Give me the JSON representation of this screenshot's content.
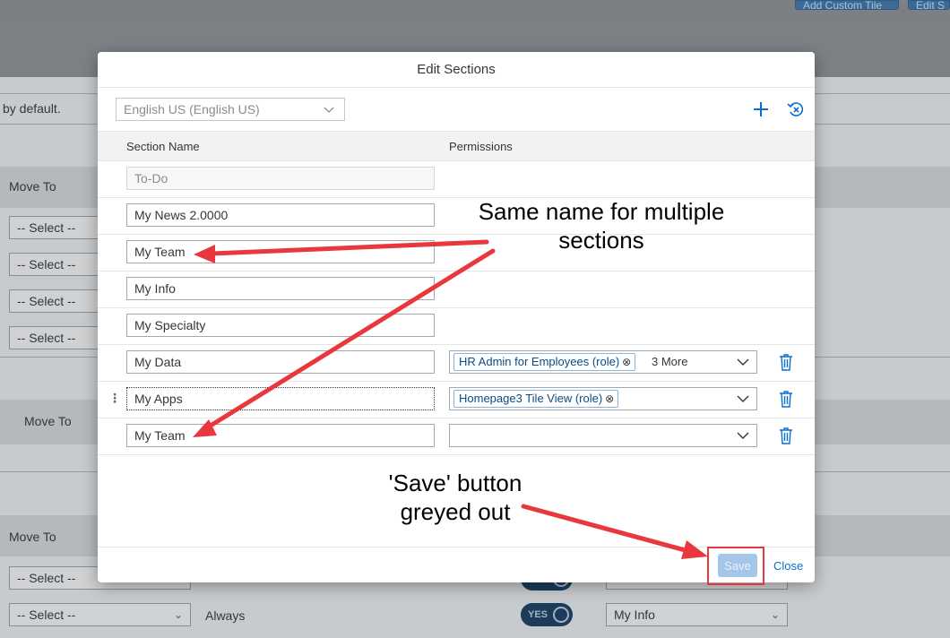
{
  "background": {
    "top_buttons": [
      "Add Custom Tile",
      "Edit S"
    ],
    "default_text": "by default.",
    "move_to": [
      "Move To",
      "Move To",
      "Move To"
    ],
    "select_placeholder": "-- Select --",
    "always_label": "Always",
    "toggle_label": "YES",
    "bottom_select_value": "My Info"
  },
  "dialog": {
    "title": "Edit Sections",
    "language": "English US (English US)",
    "columns": {
      "section_name": "Section Name",
      "permissions": "Permissions"
    },
    "rows": [
      {
        "name": "To-Do"
      },
      {
        "name": "My News 2.0000"
      },
      {
        "name": "My Team"
      },
      {
        "name": "My Info"
      },
      {
        "name": "My Specialty"
      },
      {
        "name": "My Data",
        "token": "HR Admin for Employees (role)",
        "more": "3 More"
      },
      {
        "name": "My Apps",
        "token": "Homepage3 Tile View (role)"
      },
      {
        "name": "My Team"
      }
    ],
    "save_label": "Save",
    "close_label": "Close"
  },
  "annotations": {
    "same_name_line1": "Same name for multiple",
    "same_name_line2": "sections",
    "save_line1": "'Save' button",
    "save_line2": "greyed out"
  },
  "colors": {
    "accent": "#0a6ed1",
    "annotation": "#e8383d",
    "save_disabled": "#a4c6e8"
  }
}
